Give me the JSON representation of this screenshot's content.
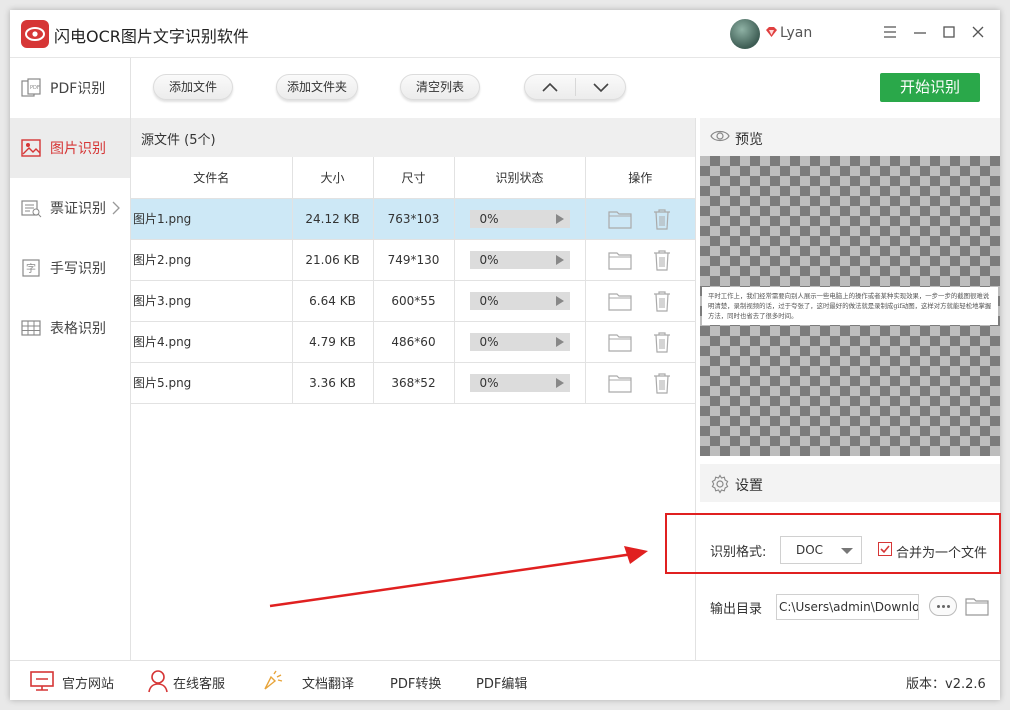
{
  "app": {
    "title": "闪电OCR图片文字识别软件",
    "username": "Lyan"
  },
  "sidebar": {
    "items": [
      {
        "label": "PDF识别",
        "icon": "pdf-icon"
      },
      {
        "label": "图片识别",
        "icon": "image-icon",
        "active": true
      },
      {
        "label": "票证识别",
        "icon": "ticket-icon"
      },
      {
        "label": "手写识别",
        "icon": "handwriting-icon"
      },
      {
        "label": "表格识别",
        "icon": "table-icon"
      }
    ]
  },
  "toolbar": {
    "add_file": "添加文件",
    "add_folder": "添加文件夹",
    "clear_list": "清空列表",
    "start": "开始识别"
  },
  "files": {
    "header": "源文件 (5个)",
    "columns": [
      "文件名",
      "大小",
      "尺寸",
      "识别状态",
      "操作"
    ],
    "rows": [
      {
        "name": "图片1.png",
        "size": "24.12 KB",
        "dims": "763*103",
        "progress": "0%",
        "selected": true
      },
      {
        "name": "图片2.png",
        "size": "21.06 KB",
        "dims": "749*130",
        "progress": "0%"
      },
      {
        "name": "图片3.png",
        "size": "6.64 KB",
        "dims": "600*55",
        "progress": "0%"
      },
      {
        "name": "图片4.png",
        "size": "4.79 KB",
        "dims": "486*60",
        "progress": "0%"
      },
      {
        "name": "图片5.png",
        "size": "3.36 KB",
        "dims": "368*52",
        "progress": "0%"
      }
    ]
  },
  "preview": {
    "title": "预览",
    "snippet": "平时工作上，我们经常需要向别人展示一些电脑上的操作或者某种实现效果，一步一步的截图很难说明清楚，录制视频的话，过于夸张了，这时最好的做法就是录制成gif动图，这样对方就能轻松地掌握方法，同时也省去了很多时间。"
  },
  "settings": {
    "title": "设置",
    "format_label": "识别格式:",
    "format_value": "DOC",
    "merge_label": "合并为一个文件",
    "merge_checked": true,
    "output_label": "输出目录",
    "output_path": "C:\\Users\\admin\\Downloads"
  },
  "footer": {
    "website": "官方网站",
    "support": "在线客服",
    "translate": "文档翻译",
    "pdf_convert": "PDF转换",
    "pdf_edit": "PDF编辑",
    "version": "版本：v2.2.6"
  },
  "colors": {
    "brand": "#d63636",
    "start": "#2aa84a",
    "selected_row": "#cde8f6",
    "annotation": "#e02020"
  }
}
